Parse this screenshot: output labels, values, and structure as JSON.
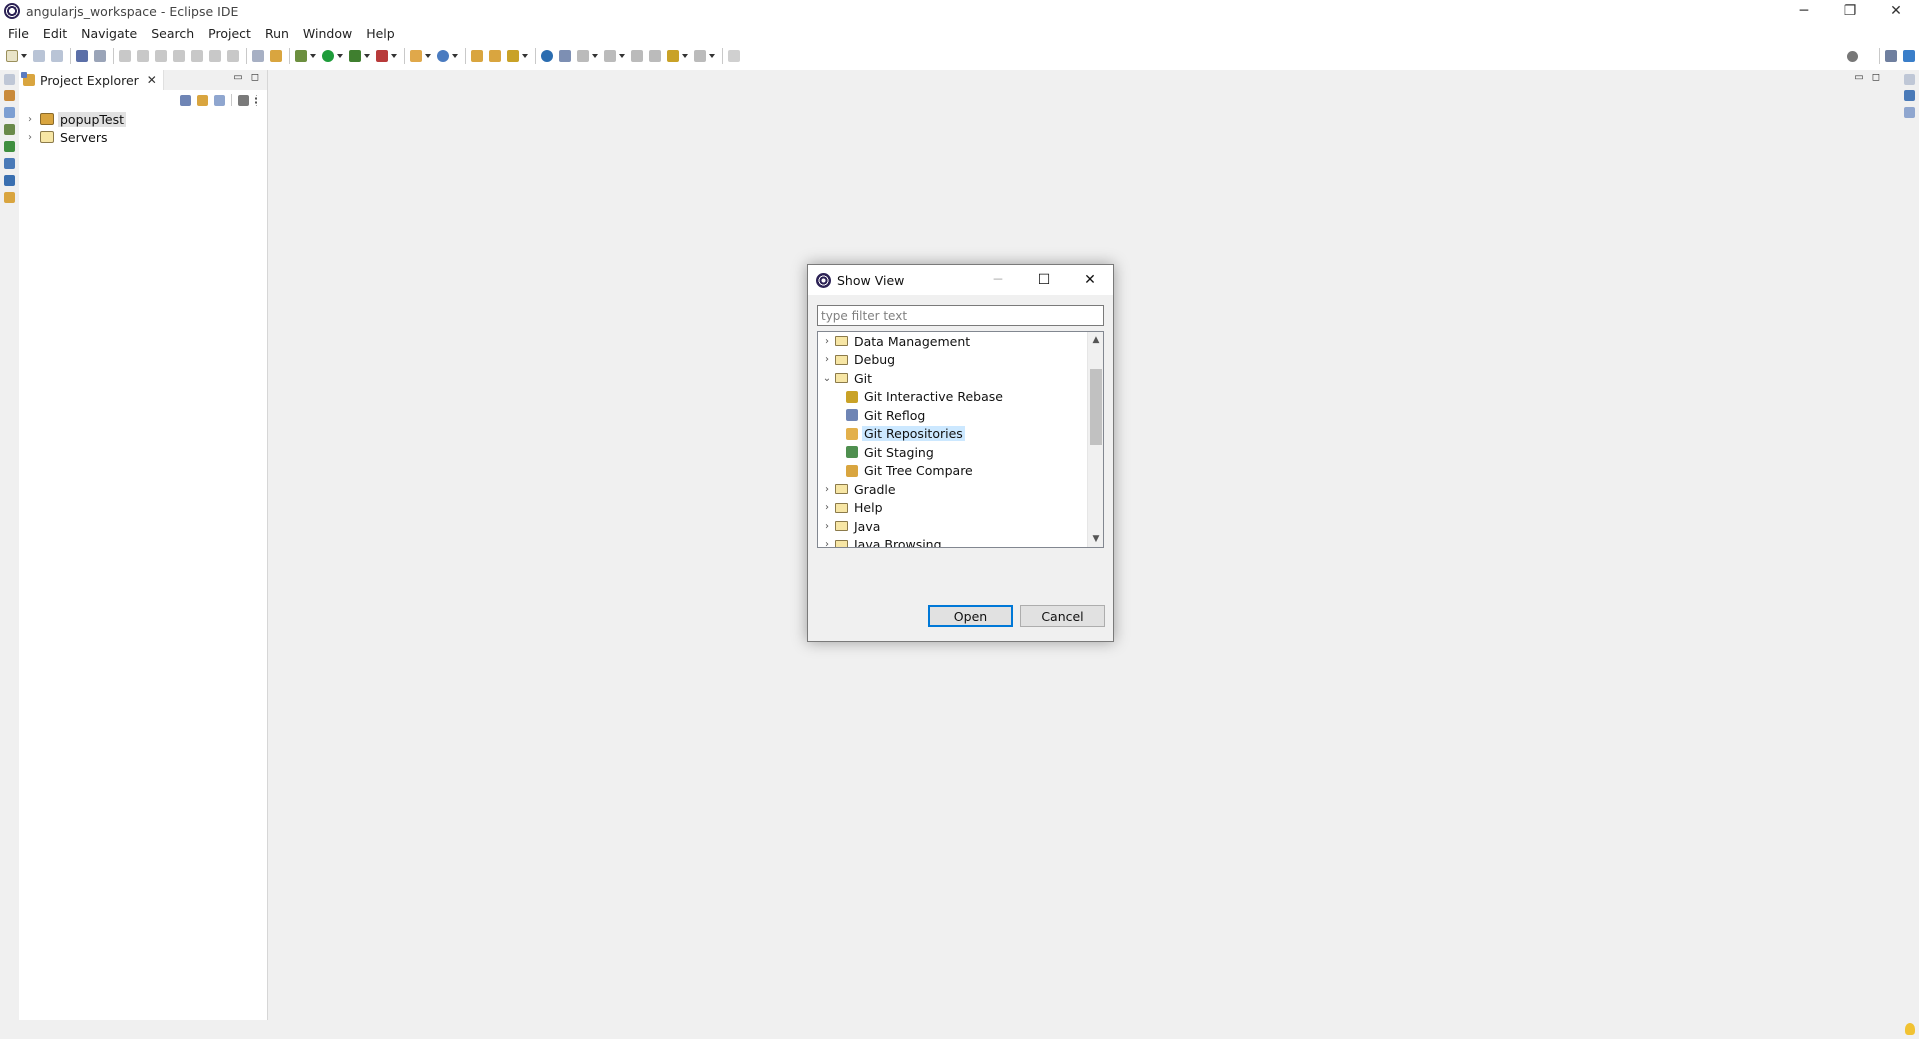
{
  "window": {
    "title": "angularjs_workspace - Eclipse IDE",
    "controls": {
      "minimize": "─",
      "restore": "❐",
      "close": "✕"
    }
  },
  "menu": {
    "items": [
      "File",
      "Edit",
      "Navigate",
      "Search",
      "Project",
      "Run",
      "Window",
      "Help"
    ]
  },
  "explorer": {
    "tab_label": "Project Explorer",
    "tab_close": "✕",
    "minimize": "▭",
    "maximize": "◻",
    "tree": [
      {
        "label": "popupTest",
        "twisty": "›",
        "selected": true
      },
      {
        "label": "Servers",
        "twisty": "›",
        "selected": false
      }
    ]
  },
  "dialog": {
    "title": "Show View",
    "controls": {
      "minimize": "─",
      "maximize": "☐",
      "close": "✕"
    },
    "filter_placeholder": "type filter text",
    "tree": [
      {
        "label": "Data Management",
        "kind": "folder",
        "twisty": "›"
      },
      {
        "label": "Debug",
        "kind": "folder",
        "twisty": "›"
      },
      {
        "label": "Git",
        "kind": "folder",
        "twisty": "⌄"
      },
      {
        "label": "Git Interactive Rebase",
        "kind": "view"
      },
      {
        "label": "Git Reflog",
        "kind": "view"
      },
      {
        "label": "Git Repositories",
        "kind": "view",
        "selected": true
      },
      {
        "label": "Git Staging",
        "kind": "view"
      },
      {
        "label": "Git Tree Compare",
        "kind": "view"
      },
      {
        "label": "Gradle",
        "kind": "folder",
        "twisty": "›"
      },
      {
        "label": "Help",
        "kind": "folder",
        "twisty": "›"
      },
      {
        "label": "Java",
        "kind": "folder",
        "twisty": "›"
      },
      {
        "label": "Java Browsing",
        "kind": "folder",
        "twisty": "›"
      }
    ],
    "scroll_up": "▲",
    "scroll_down": "▼",
    "open_label": "Open",
    "cancel_label": "Cancel"
  },
  "colors": {
    "selection": "#cce8ff",
    "default_button_border": "#0078d7"
  }
}
